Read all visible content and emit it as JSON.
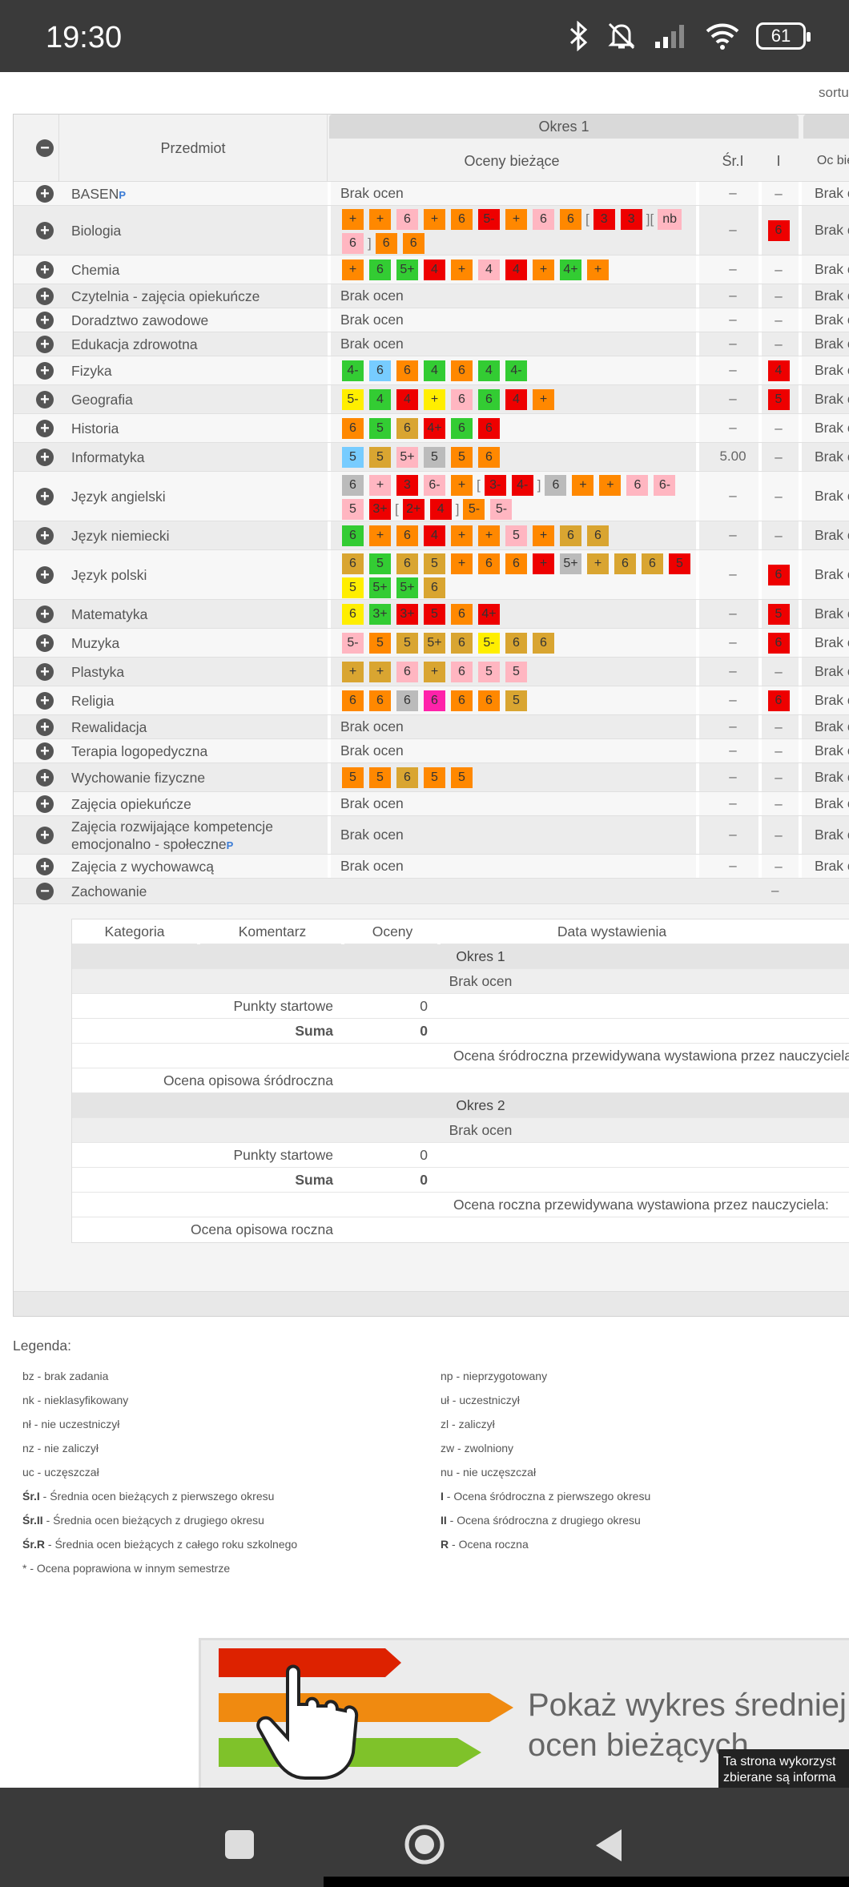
{
  "status_bar": {
    "time": "19:30",
    "battery": "61"
  },
  "sort_label": "sortu",
  "table": {
    "header": {
      "period1": "Okres 1",
      "subject": "Przedmiot",
      "current_grades": "Oceny bieżące",
      "avg1": "Śr.I",
      "term1": "I",
      "next_col": "Oc bież"
    },
    "no_grades": "Brak ocen",
    "dash": "–",
    "cut_text": "Brak o"
  },
  "subjects": [
    {
      "name": "BASEN",
      "info": true,
      "grades": [],
      "avg": "–",
      "term": "–"
    },
    {
      "name": "Biologia",
      "grades": [
        "+",
        "+",
        "6",
        "+",
        "6",
        "5-",
        "+",
        "6",
        "6",
        "[",
        "3",
        "3",
        "][",
        "nb",
        "6",
        "]",
        "6",
        "6"
      ],
      "avg": "–",
      "term": "6"
    },
    {
      "name": "Chemia",
      "grades": [
        "+",
        "6",
        "5+",
        "4",
        "+",
        "4",
        "4",
        "+",
        "4+",
        "+"
      ],
      "avg": "–",
      "term": "–"
    },
    {
      "name": "Czytelnia - zajęcia opiekuńcze",
      "grades": [],
      "avg": "–",
      "term": "–"
    },
    {
      "name": "Doradztwo zawodowe",
      "grades": [],
      "avg": "–",
      "term": "–"
    },
    {
      "name": "Edukacja zdrowotna",
      "grades": [],
      "avg": "–",
      "term": "–"
    },
    {
      "name": "Fizyka",
      "grades": [
        "4-",
        "6",
        "6",
        "4",
        "6",
        "4",
        "4-"
      ],
      "avg": "–",
      "term": "4"
    },
    {
      "name": "Geografia",
      "grades": [
        "5-",
        "4",
        "4",
        "+",
        "6",
        "6",
        "4",
        "+"
      ],
      "avg": "–",
      "term": "5"
    },
    {
      "name": "Historia",
      "grades": [
        "6",
        "5",
        "6",
        "4+",
        "6",
        "6"
      ],
      "avg": "–",
      "term": "–"
    },
    {
      "name": "Informatyka",
      "grades": [
        "5",
        "5",
        "5+",
        "5",
        "5",
        "6"
      ],
      "avg": "5.00",
      "term": "–"
    },
    {
      "name": "Język angielski",
      "grades": [
        "6",
        "+",
        "3",
        "6-",
        "+",
        "[",
        "3-",
        "4-",
        "]",
        "6",
        "+",
        "+",
        "6",
        "6-",
        "5",
        "3+",
        "[",
        "2+",
        "4",
        "]",
        "5-",
        "5-"
      ],
      "avg": "–",
      "term": "–"
    },
    {
      "name": "Język niemiecki",
      "grades": [
        "6",
        "+",
        "6",
        "4",
        "+",
        "+",
        "5",
        "+",
        "6",
        "6"
      ],
      "avg": "–",
      "term": "–"
    },
    {
      "name": "Język polski",
      "grades": [
        "6",
        "5",
        "6",
        "5",
        "+",
        "6",
        "6",
        "+",
        "5+",
        "+",
        "6",
        "6",
        "5",
        "5",
        "5+",
        "5+",
        "6"
      ],
      "avg": "–",
      "term": "6"
    },
    {
      "name": "Matematyka",
      "grades": [
        "6",
        "3+",
        "3+",
        "5",
        "6",
        "4+"
      ],
      "avg": "–",
      "term": "5"
    },
    {
      "name": "Muzyka",
      "grades": [
        "5-",
        "5",
        "5",
        "5+",
        "6",
        "5-",
        "6",
        "6"
      ],
      "avg": "–",
      "term": "6"
    },
    {
      "name": "Plastyka",
      "grades": [
        "+",
        "+",
        "6",
        "+",
        "6",
        "5",
        "5"
      ],
      "avg": "–",
      "term": "–"
    },
    {
      "name": "Religia",
      "grades": [
        "6",
        "6",
        "6",
        "6",
        "6",
        "6",
        "5"
      ],
      "avg": "–",
      "term": "6"
    },
    {
      "name": "Rewalidacja",
      "grades": [],
      "avg": "–",
      "term": "–"
    },
    {
      "name": "Terapia logopedyczna",
      "grades": [],
      "avg": "–",
      "term": "–"
    },
    {
      "name": "Wychowanie fizyczne",
      "grades": [
        "5",
        "5",
        "6",
        "5",
        "5"
      ],
      "avg": "–",
      "term": "–"
    },
    {
      "name": "Zajęcia opiekuńcze",
      "grades": [],
      "avg": "–",
      "term": "–"
    },
    {
      "name": "Zajęcia rozwijające kompetencje emocjonalno - społeczne",
      "info": true,
      "grades": [],
      "avg": "–",
      "term": "–"
    },
    {
      "name": "Zajęcia z wychowawcą",
      "grades": [],
      "avg": "–",
      "term": "–"
    }
  ],
  "behavior": {
    "name": "Zachowanie",
    "term": "–",
    "headers": {
      "category": "Kategoria",
      "comment": "Komentarz",
      "grades": "Oceny",
      "date": "Data wystawienia"
    },
    "period1": {
      "title": "Okres 1",
      "no_grades": "Brak ocen",
      "start_points": "Punkty startowe",
      "start_value": "0",
      "sum": "Suma",
      "sum_value": "0",
      "predicted": "Ocena śródroczna przewidywana wystawiona przez nauczyciela:",
      "descriptive": "Ocena opisowa śródroczna"
    },
    "period2": {
      "title": "Okres 2",
      "no_grades": "Brak ocen",
      "start_points": "Punkty startowe",
      "start_value": "0",
      "sum": "Suma",
      "sum_value": "0",
      "predicted": "Ocena roczna przewidywana wystawiona przez nauczyciela:",
      "descriptive": "Ocena opisowa roczna"
    }
  },
  "legend": {
    "title": "Legenda:",
    "left": [
      {
        "k": "bz",
        "v": " - brak zadania"
      },
      {
        "k": "nk",
        "v": " - nieklasyfikowany"
      },
      {
        "k": "nł",
        "v": " - nie uczestniczył"
      },
      {
        "k": "nz",
        "v": " - nie zaliczył"
      },
      {
        "k": "uc",
        "v": " - uczęszczał"
      },
      {
        "k": "Śr.I",
        "v": " - Średnia ocen bieżących z pierwszego okresu",
        "bold": true
      },
      {
        "k": "Śr.II",
        "v": " - Średnia ocen bieżących z drugiego okresu",
        "bold": true
      },
      {
        "k": "Śr.R",
        "v": " - Średnia ocen bieżących z całego roku szkolnego",
        "bold": true
      },
      {
        "k": "*",
        "v": " - Ocena poprawiona w innym semestrze"
      }
    ],
    "right": [
      {
        "k": "np",
        "v": " - nieprzygotowany"
      },
      {
        "k": "uł",
        "v": " - uczestniczył"
      },
      {
        "k": "zl",
        "v": " - zaliczył"
      },
      {
        "k": "zw",
        "v": " - zwolniony"
      },
      {
        "k": "nu",
        "v": " - nie uczęszczał"
      },
      {
        "k": "I",
        "v": " - Ocena śródroczna z pierwszego okresu",
        "bold": true
      },
      {
        "k": "II",
        "v": " - Ocena śródroczna z drugiego okresu",
        "bold": true
      },
      {
        "k": "R",
        "v": " - Ocena roczna",
        "bold": true
      }
    ]
  },
  "banner": {
    "line1": "Pokaż wykres średniej",
    "line2": "ocen bieżących"
  },
  "cookie": {
    "text": "Ta strona wykorzyst zbierane są informa osobowe. Wykorzys"
  },
  "colors": {
    "orange": "#ff8800",
    "red": "#ee0000",
    "pink": "#ffb6c1",
    "green": "#33cc33",
    "yellow": "#ffee00",
    "gray": "#bbbbbb",
    "blue": "#77ccff",
    "tan": "#d9a531",
    "magenta": "#ff22aa"
  }
}
